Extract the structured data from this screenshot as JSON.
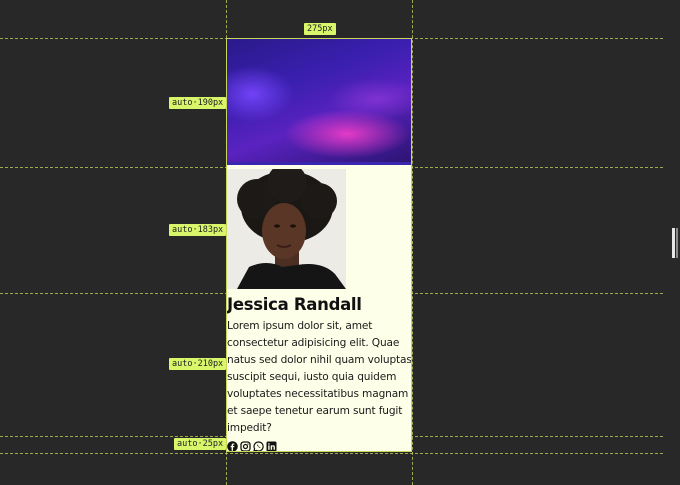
{
  "annotations": {
    "width_label": "275px",
    "row1_label": "auto·190px",
    "row2_label": "auto·183px",
    "row3_label": "auto·210px",
    "row4_label": "auto·25px"
  },
  "card": {
    "name": "Jessica Randall",
    "bio": "Lorem ipsum dolor sit, amet consectetur adipisicing elit. Quae natus sed dolor nihil quam voluptas suscipit sequi, iusto quia quidem voluptates necessitatibus magnam et saepe tenetur earum sunt fugit impedit?",
    "social_icons": [
      "facebook-icon",
      "instagram-icon",
      "whatsapp-icon",
      "linkedin-icon"
    ]
  },
  "colors": {
    "background": "#282828",
    "guide": "#c8d65a",
    "tag": "#d9f66b",
    "card_bg": "#fdffe9"
  }
}
